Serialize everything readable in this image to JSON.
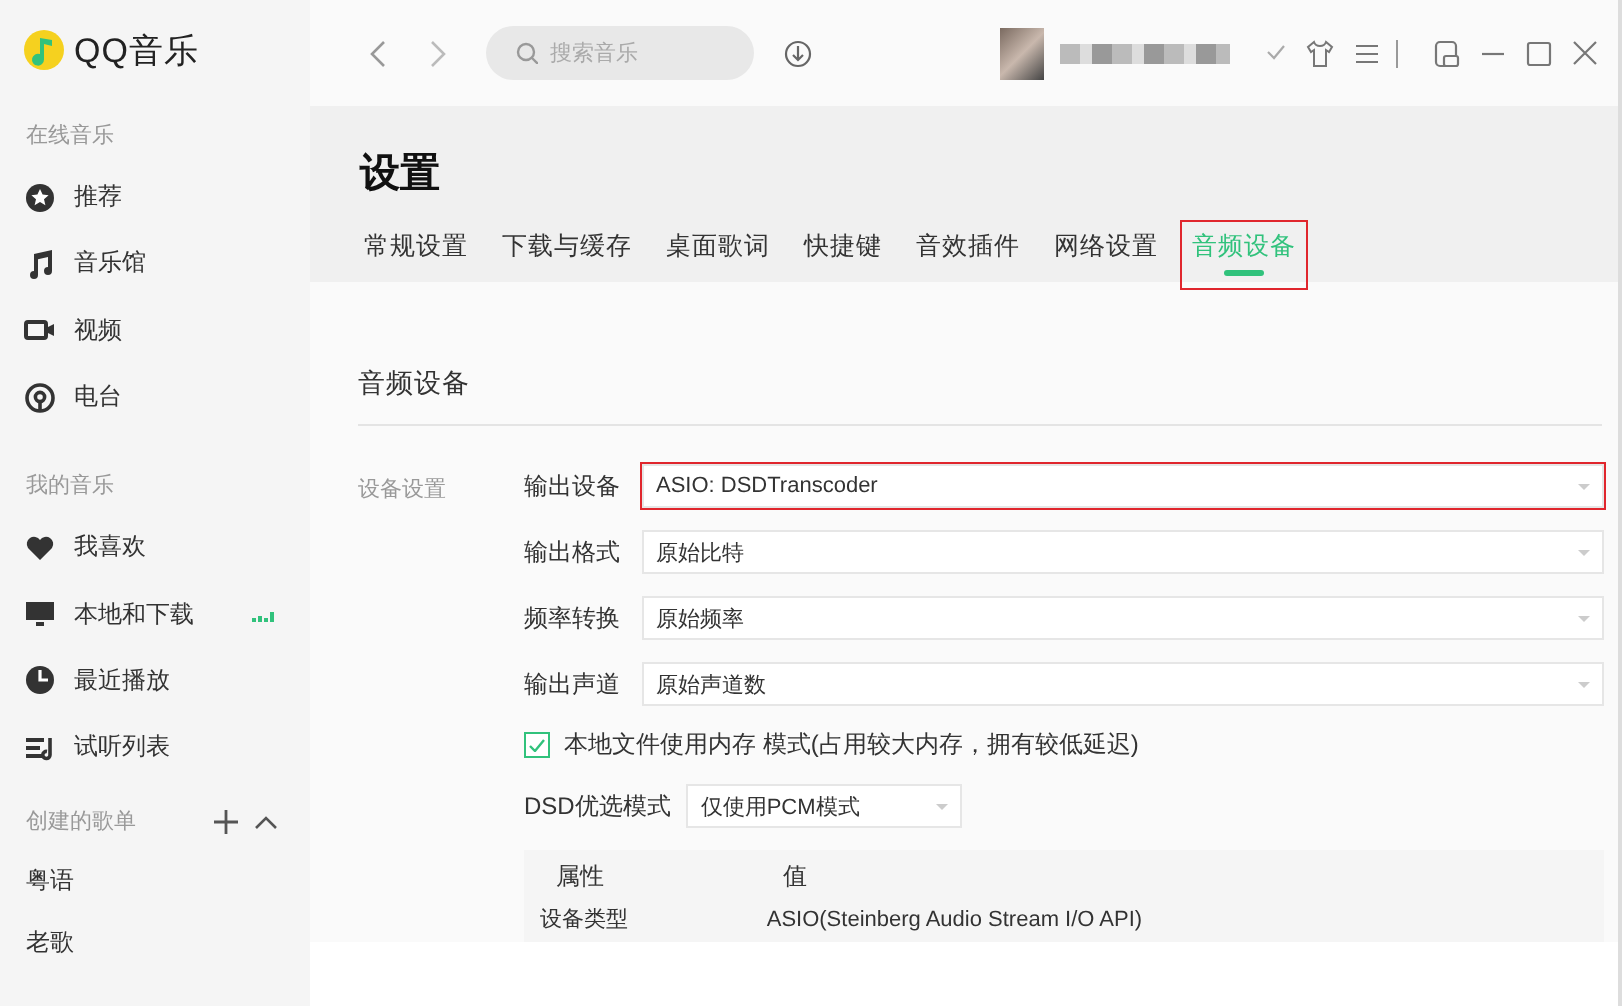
{
  "app": {
    "name": "QQ音乐"
  },
  "topbar": {
    "search": {
      "placeholder": "搜索音乐"
    }
  },
  "sidebar": {
    "sections": [
      {
        "title": "在线音乐",
        "items": [
          {
            "label": "推荐",
            "playing": false
          },
          {
            "label": "音乐馆",
            "playing": false
          },
          {
            "label": "视频",
            "playing": false
          },
          {
            "label": "电台",
            "playing": false
          }
        ]
      },
      {
        "title": "我的音乐",
        "items": [
          {
            "label": "我喜欢",
            "playing": false
          },
          {
            "label": "本地和下载",
            "playing": true
          },
          {
            "label": "最近播放",
            "playing": false
          },
          {
            "label": "试听列表",
            "playing": false
          }
        ]
      }
    ],
    "playlists": {
      "title": "创建的歌单",
      "items": [
        "粤语",
        "老歌"
      ]
    }
  },
  "page": {
    "title": "设置",
    "tabs": [
      {
        "label": "常规设置",
        "selected": false,
        "annotated": false
      },
      {
        "label": "下载与缓存",
        "selected": false,
        "annotated": false
      },
      {
        "label": "桌面歌词",
        "selected": false,
        "annotated": false
      },
      {
        "label": "快捷键",
        "selected": false,
        "annotated": false
      },
      {
        "label": "音效插件",
        "selected": false,
        "annotated": false
      },
      {
        "label": "网络设置",
        "selected": false,
        "annotated": false
      },
      {
        "label": "音频设备",
        "selected": true,
        "annotated": true
      }
    ]
  },
  "section": {
    "title": "音频设备",
    "group_label": "设备设置",
    "fields": [
      {
        "label": "输出设备",
        "value": "ASIO: DSDTranscoder",
        "annotated": true
      },
      {
        "label": "输出格式",
        "value": "原始比特",
        "annotated": false
      },
      {
        "label": "频率转换",
        "value": "原始频率",
        "annotated": false
      },
      {
        "label": "输出声道",
        "value": "原始声道数",
        "annotated": false
      }
    ],
    "option": {
      "label": "本地文件使用内存 模式(占用较大内存，拥有较低延迟)",
      "checked": true
    },
    "dsd": {
      "label": "DSD优选模式",
      "value": "仅使用PCM模式"
    },
    "table": {
      "columns": [
        "属性",
        "值"
      ],
      "rows": [
        [
          "设备类型",
          "ASIO(Steinberg Audio Stream I/O API)"
        ]
      ]
    }
  }
}
